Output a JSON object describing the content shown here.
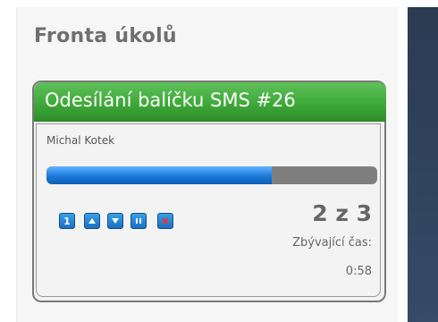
{
  "queue": {
    "title": "Fronta úkolů",
    "task": {
      "name": "Odesílání balíčku SMS #26",
      "owner": "Michal Kotek",
      "progress": 0.68,
      "count": "2 z 3",
      "remaining_label": "Zbývající čas:",
      "remaining_value": "0:58"
    },
    "controls": {
      "first_label": "1",
      "icons": [
        "priority-1-icon",
        "move-up-icon",
        "move-down-icon",
        "pause-icon",
        "cancel-icon"
      ]
    }
  },
  "colors": {
    "header_green": "#3fa93a",
    "progress_blue": "#1b78d7",
    "button_blue": "#1d6fbf",
    "cancel_red": "#e23a3a",
    "sidebar_dark": "#2b3b52"
  }
}
